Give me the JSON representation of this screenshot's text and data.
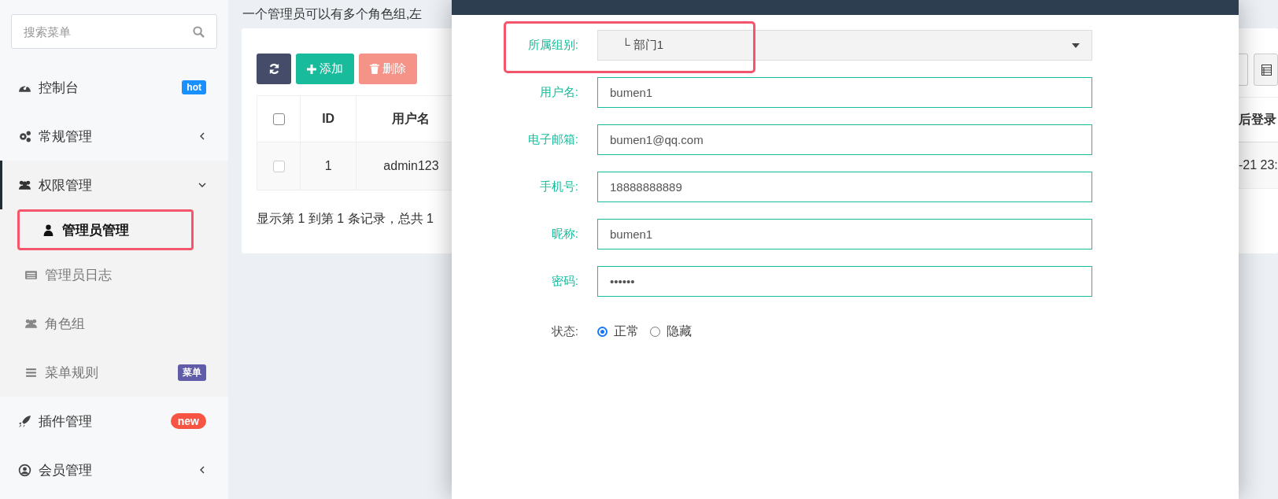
{
  "sidebar": {
    "search": {
      "placeholder": "搜索菜单"
    },
    "items": [
      {
        "label": "控制台",
        "selected": false,
        "badge": {
          "text": "hot",
          "color": "#1890ff"
        }
      },
      {
        "label": "常规管理",
        "selected": false,
        "expanded": false
      },
      {
        "label": "权限管理",
        "selected": false,
        "expanded": true,
        "children": [
          {
            "label": "管理员管理",
            "selected": true,
            "highlighted": true
          },
          {
            "label": "管理员日志",
            "selected": false
          },
          {
            "label": "角色组",
            "selected": false
          },
          {
            "label": "菜单规则",
            "selected": false,
            "badge": {
              "text": "菜单",
              "color": "#605ca8"
            }
          }
        ]
      },
      {
        "label": "插件管理",
        "selected": false,
        "badge": {
          "text": "new",
          "color": "#f75444",
          "kind": "pill"
        }
      },
      {
        "label": "会员管理",
        "selected": false,
        "expanded": false
      }
    ]
  },
  "content": {
    "notice": "一个管理员可以有多个角色组,左",
    "toolbar": [
      {
        "kind": "refresh",
        "disabled": false
      },
      {
        "kind": "add",
        "label": "添加",
        "disabled": false
      },
      {
        "kind": "delete",
        "label": "删除",
        "disabled": true
      }
    ],
    "table": {
      "header_checked": false,
      "columns": [
        "ID",
        "用户名"
      ],
      "rows": [
        {
          "checked": false,
          "cells": [
            "1",
            "admin123"
          ]
        }
      ],
      "last_column": "后登录",
      "last_cells": [
        "-21 23:"
      ]
    },
    "pagination": "显示第 1 到第 1 条记录，总共 1"
  },
  "modal": {
    "fields": [
      {
        "kind": "select",
        "label": "所属组别:",
        "value": "└ 部门1",
        "highlighted": true
      },
      {
        "kind": "text",
        "label": "用户名:",
        "value": "bumen1"
      },
      {
        "kind": "text",
        "label": "电子邮箱:",
        "value": "bumen1@qq.com"
      },
      {
        "kind": "text",
        "label": "手机号:",
        "value": "18888888889"
      },
      {
        "kind": "text",
        "label": "昵称:",
        "value": "bumen1"
      },
      {
        "kind": "password",
        "label": "密码:",
        "value": "••••••"
      },
      {
        "kind": "radio",
        "label": "状态:",
        "options": [
          {
            "label": "正常",
            "selected": true
          },
          {
            "label": "隐藏",
            "selected": false
          }
        ]
      }
    ]
  }
}
